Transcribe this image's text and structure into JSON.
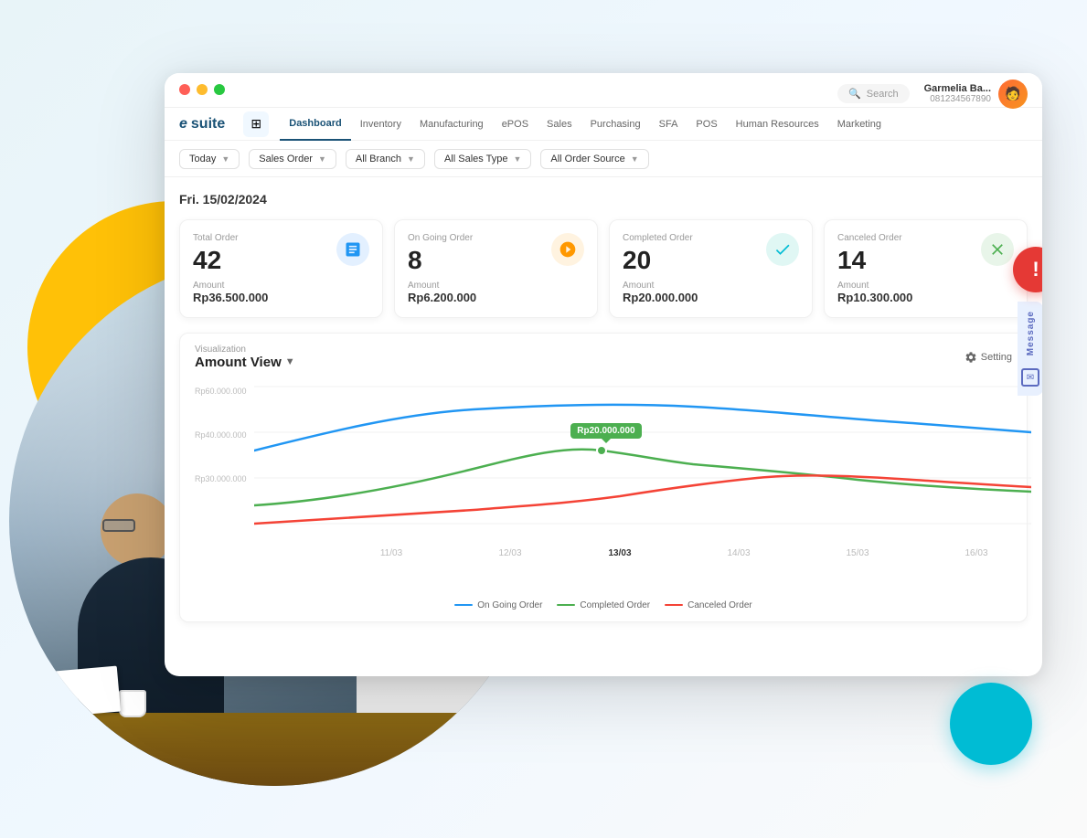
{
  "window": {
    "title": "eSuite Dashboard"
  },
  "header": {
    "search_placeholder": "Search",
    "user_name": "Garmelia Ba...",
    "user_phone": "081234567890"
  },
  "nav": {
    "logo": "esuite",
    "items": [
      {
        "label": "Dashboard",
        "active": true
      },
      {
        "label": "Inventory"
      },
      {
        "label": "Manufacturing"
      },
      {
        "label": "ePOS"
      },
      {
        "label": "Sales"
      },
      {
        "label": "Purchasing"
      },
      {
        "label": "SFA"
      },
      {
        "label": "POS"
      },
      {
        "label": "Human Resources"
      },
      {
        "label": "Marketing"
      }
    ]
  },
  "filters": {
    "date": {
      "label": "Today",
      "value": "Today"
    },
    "order_type": {
      "label": "Sales Order",
      "value": "Sales Order"
    },
    "branch": {
      "label": "All Branch",
      "value": "All Branch"
    },
    "sales_type": {
      "label": "All Sales Type",
      "value": "All Sales Type"
    },
    "order_source": {
      "label": "All Order Source",
      "value": "All Order Source"
    }
  },
  "dashboard": {
    "date": "Fri. 15/02/2024",
    "stats": [
      {
        "label": "Total Order",
        "value": "42",
        "amount_label": "Amount",
        "amount": "Rp36.500.000",
        "icon": "📋",
        "icon_class": "icon-blue"
      },
      {
        "label": "On Going Order",
        "value": "8",
        "amount_label": "Amount",
        "amount": "Rp6.200.000",
        "icon": "🔔",
        "icon_class": "icon-orange"
      },
      {
        "label": "Completed Order",
        "value": "20",
        "amount_label": "Amount",
        "amount": "Rp20.000.000",
        "icon": "✅",
        "icon_class": "icon-teal"
      },
      {
        "label": "Canceled Order",
        "value": "14",
        "amount_label": "Amount",
        "amount": "Rp10.300.000",
        "icon": "⚠️",
        "icon_class": "icon-green"
      }
    ],
    "chart": {
      "visualization_label": "Visualization",
      "title": "Amount View",
      "setting_label": "Setting",
      "y_labels": [
        "Rp60.000.000",
        "Rp40.000.000",
        "Rp30.000.000"
      ],
      "x_labels": [
        "11/03",
        "12/03",
        "13/03",
        "14/03",
        "15/03",
        "16/03"
      ],
      "tooltip_value": "Rp20.000.000",
      "legend": [
        {
          "label": "On Going Order",
          "color": "#2196F3"
        },
        {
          "label": "Completed Order",
          "color": "#4CAF50"
        },
        {
          "label": "Canceled Order",
          "color": "#F44336"
        }
      ]
    }
  },
  "message_panel": {
    "label": "Message"
  },
  "notification_button": {
    "label": "!"
  }
}
